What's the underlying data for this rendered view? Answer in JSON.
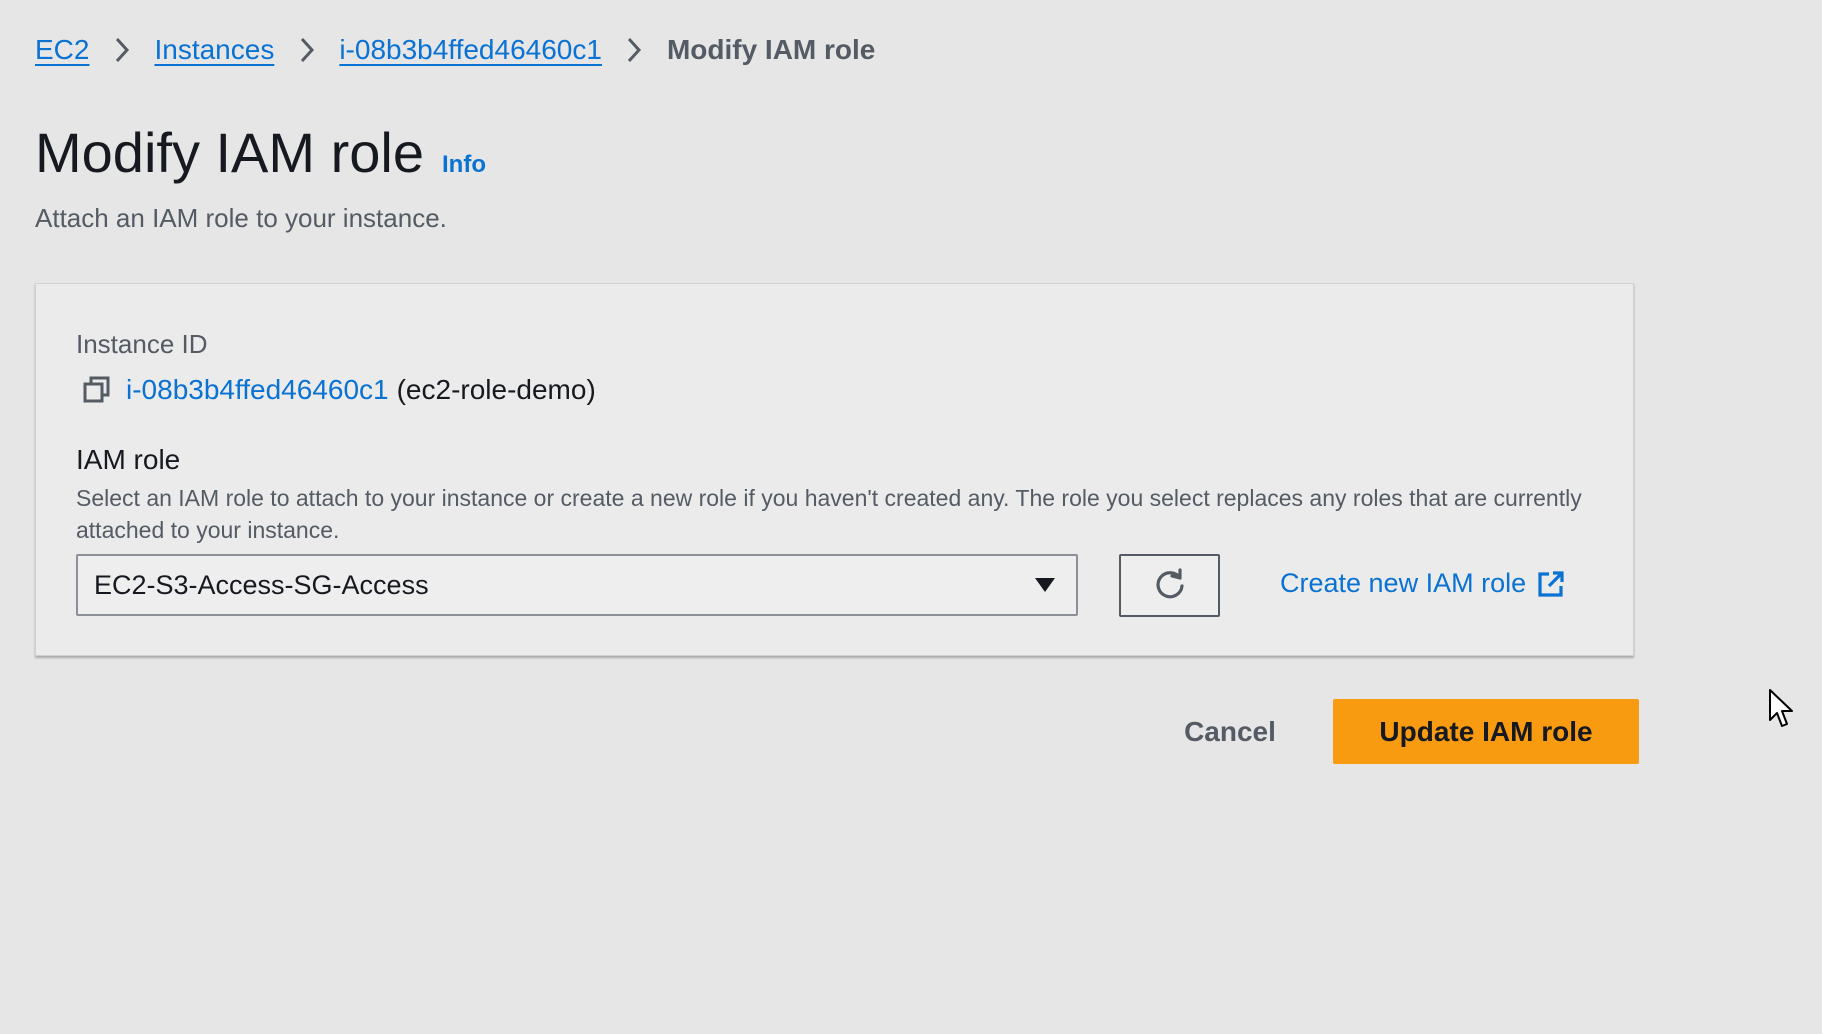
{
  "breadcrumb": {
    "items": [
      {
        "label": "EC2"
      },
      {
        "label": "Instances"
      },
      {
        "label": "i-08b3b4ffed46460c1"
      }
    ],
    "current": "Modify IAM role"
  },
  "header": {
    "title": "Modify IAM role",
    "info_label": "Info",
    "description": "Attach an IAM role to your instance."
  },
  "instance": {
    "label": "Instance ID",
    "id": "i-08b3b4ffed46460c1",
    "name": "(ec2-role-demo)"
  },
  "iam_role": {
    "label": "IAM role",
    "description": "Select an IAM role to attach to your instance or create a new role if you haven't created any. The role you select replaces any roles that are currently attached to your instance.",
    "selected_value": "EC2-S3-Access-SG-Access",
    "create_link_label": "Create new IAM role"
  },
  "actions": {
    "cancel_label": "Cancel",
    "update_label": "Update IAM role"
  },
  "icons": {
    "breadcrumb_separator": "chevron-right-icon",
    "copy": "copy-icon",
    "dropdown": "caret-down-icon",
    "refresh": "refresh-icon",
    "external": "external-link-icon",
    "cursor": "mouse-pointer-icon"
  },
  "colors": {
    "link": "#0972d3",
    "primary_button": "#f89b11",
    "background": "#e6e6e6",
    "text": "#16191f",
    "muted_text": "#545b64"
  }
}
